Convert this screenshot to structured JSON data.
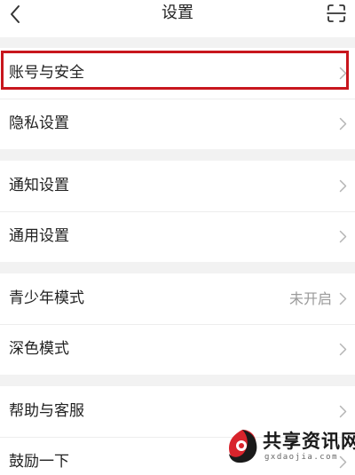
{
  "header": {
    "title": "设置",
    "back_icon": "chevron-left-icon",
    "scan_icon": "scan-icon"
  },
  "groups": [
    {
      "items": [
        {
          "label": "账号与安全",
          "value": "",
          "highlighted": true
        },
        {
          "label": "隐私设置",
          "value": ""
        }
      ]
    },
    {
      "items": [
        {
          "label": "通知设置",
          "value": ""
        },
        {
          "label": "通用设置",
          "value": ""
        }
      ]
    },
    {
      "items": [
        {
          "label": "青少年模式",
          "value": "未开启"
        },
        {
          "label": "深色模式",
          "value": ""
        }
      ]
    },
    {
      "items": [
        {
          "label": "帮助与客服",
          "value": ""
        },
        {
          "label": "鼓励一下",
          "value": ""
        }
      ]
    }
  ],
  "watermark": {
    "title": "共享资讯网",
    "url": "gxdaojia.com"
  },
  "colors": {
    "highlight": "#c8161d",
    "background": "#f2f2f2",
    "card": "#ffffff",
    "value_text": "#9a9a9a"
  }
}
